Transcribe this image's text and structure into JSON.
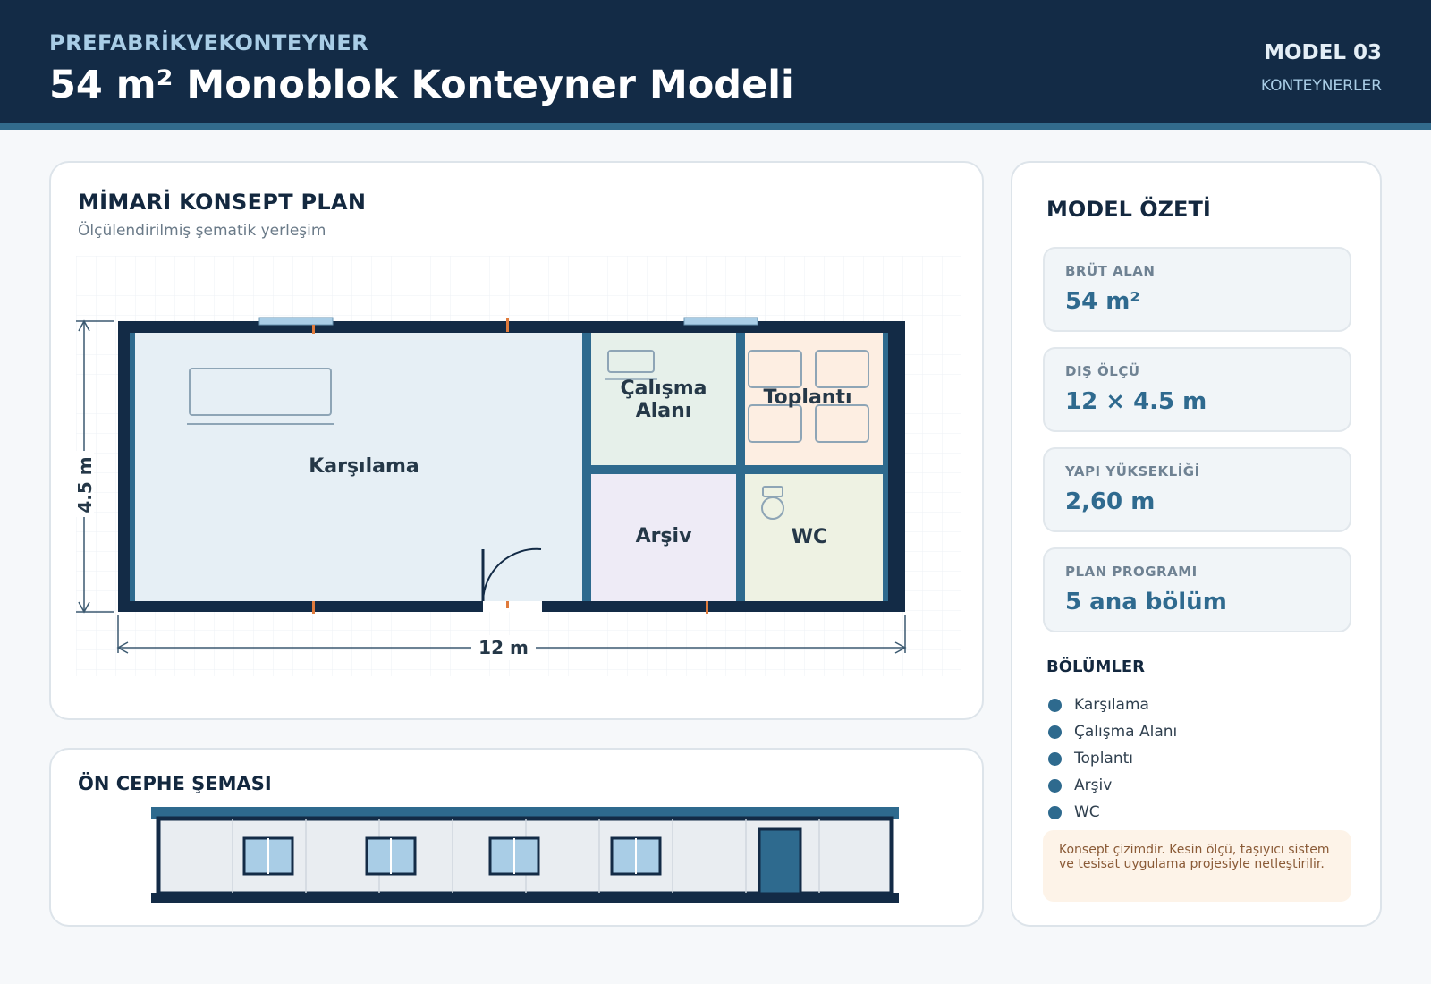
{
  "header": {
    "brand": "PREFABRİKVEKONTEYNER",
    "title": "54 m² Monoblok Konteyner Modeli",
    "model_no": "MODEL 03",
    "category": "KONTEYNERLER"
  },
  "plan": {
    "title": "MİMARİ KONSEPT PLAN",
    "subtitle": "Ölçülendirilmiş şematik yerleşim",
    "rooms": {
      "karsilama": "Karşılama",
      "calisma_1": "Çalışma",
      "calisma_2": "Alanı",
      "toplanti": "Toplantı",
      "arsiv": "Arşiv",
      "wc": "WC"
    },
    "dim_width": "12 m",
    "dim_height": "4.5 m"
  },
  "facade": {
    "title": "ÖN CEPHE ŞEMASI"
  },
  "summary": {
    "title": "MODEL ÖZETİ",
    "stats": [
      {
        "label": "BRÜT ALAN",
        "value": "54 m²"
      },
      {
        "label": "DIŞ ÖLÇÜ",
        "value": "12 × 4.5 m"
      },
      {
        "label": "YAPI YÜKSEKLİĞİ",
        "value": "2,60 m"
      },
      {
        "label": "PLAN PROGRAMI",
        "value": "5 ana bölüm"
      }
    ],
    "sections_title": "BÖLÜMLER",
    "sections": [
      "Karşılama",
      "Çalışma Alanı",
      "Toplantı",
      "Arşiv",
      "WC"
    ],
    "note": "Konsept çizimdir. Kesin ölçü, taşıyıcı sistem ve tesisat uygulama projesiyle netleştirilir."
  },
  "colors": {
    "navy": "#132b46",
    "accent": "#326b8c",
    "karsilama": "#e6eff5",
    "calisma": "#e6f0ea",
    "toplanti": "#fdeee2",
    "arsiv": "#eeebf6",
    "wc": "#eef2e3",
    "marker": "#e07b3c"
  }
}
